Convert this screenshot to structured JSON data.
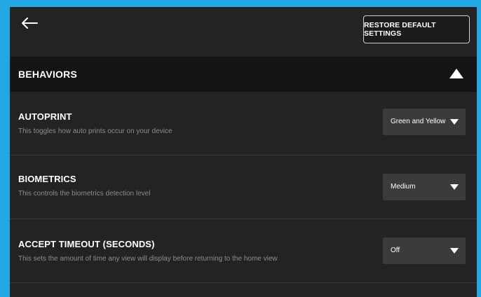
{
  "colors": {
    "frame": "#22a7e3",
    "background": "#232323",
    "header_background": "#141414",
    "dropdown_background": "#3b3b3b",
    "text_primary": "#ffffff",
    "text_secondary": "#8d8d8d"
  },
  "topbar": {
    "back_icon": "arrow-left-icon",
    "restore_label": "RESTORE DEFAULT SETTINGS"
  },
  "section": {
    "title": "BEHAVIORS",
    "toggle_icon": "triangle-up-icon",
    "expanded": true
  },
  "settings": [
    {
      "title": "AUTOPRINT",
      "description": "This toggles how auto prints occur on your device",
      "value": "Green and Yellow",
      "caret_icon": "triangle-down-icon"
    },
    {
      "title": "BIOMETRICS",
      "description": "This controls the biometrics detection level",
      "value": "Medium",
      "caret_icon": "triangle-down-icon"
    },
    {
      "title": "ACCEPT TIMEOUT (SECONDS)",
      "description": "This sets the amount of time any view will display before returning to the home view",
      "value": "Off",
      "caret_icon": "triangle-down-icon"
    }
  ]
}
